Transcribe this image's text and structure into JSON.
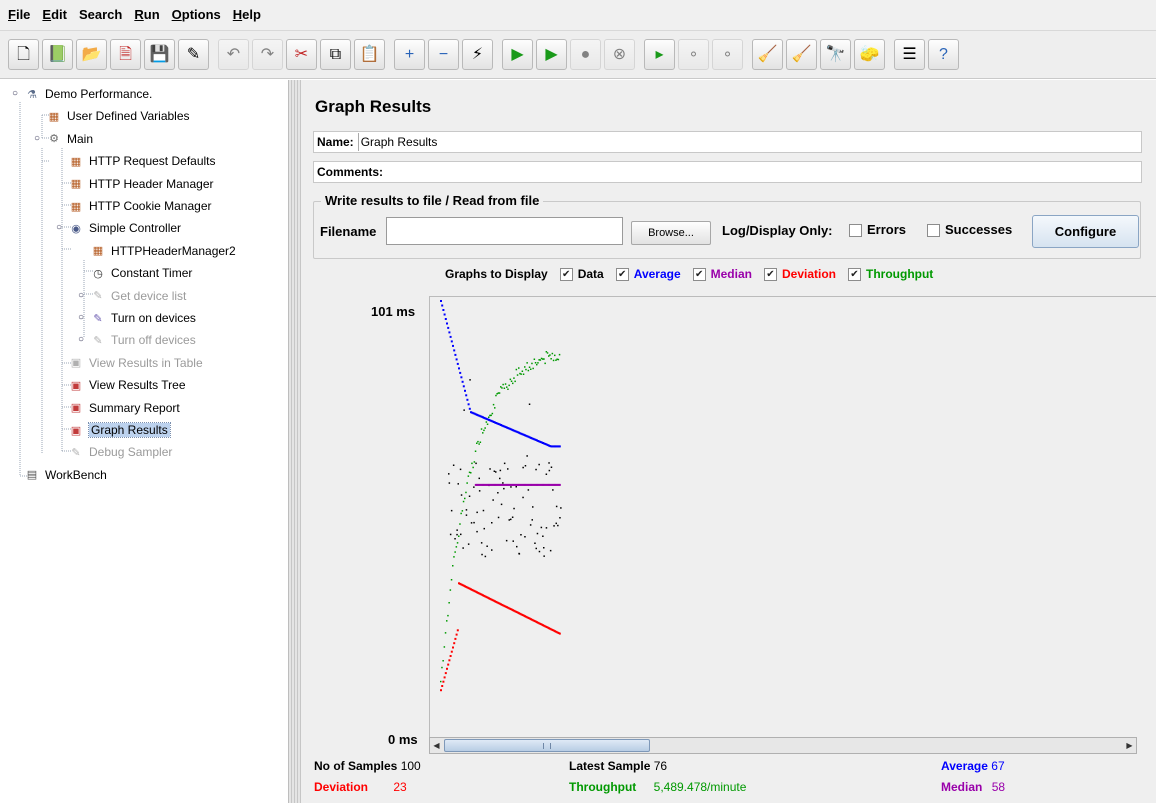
{
  "menu": [
    {
      "label": "File",
      "mnemonic_index": 0
    },
    {
      "label": "Edit",
      "mnemonic_index": 0
    },
    {
      "label": "Search",
      "mnemonic_index": -1
    },
    {
      "label": "Run",
      "mnemonic_index": 0
    },
    {
      "label": "Options",
      "mnemonic_index": 0
    },
    {
      "label": "Help",
      "mnemonic_index": 0
    }
  ],
  "toolbar": [
    {
      "name": "new-icon",
      "glyph": "🗋"
    },
    {
      "name": "templates-icon",
      "glyph": "📗"
    },
    {
      "name": "open-icon",
      "glyph": "📂"
    },
    {
      "name": "close-icon",
      "glyph": "🗎"
    },
    {
      "name": "save-icon",
      "glyph": "💾"
    },
    {
      "name": "save-as-icon",
      "glyph": "✎"
    },
    {
      "sep": true
    },
    {
      "name": "undo-icon",
      "glyph": "↶",
      "disabled": true
    },
    {
      "name": "redo-icon",
      "glyph": "↷",
      "disabled": true
    },
    {
      "name": "cut-icon",
      "glyph": "✂"
    },
    {
      "name": "copy-icon",
      "glyph": "⧉"
    },
    {
      "name": "paste-icon",
      "glyph": "📋"
    },
    {
      "sep": true
    },
    {
      "name": "expand-all-icon",
      "glyph": "+"
    },
    {
      "name": "collapse-all-icon",
      "glyph": "−"
    },
    {
      "name": "toggle-icon",
      "glyph": "⚡"
    },
    {
      "sep": true
    },
    {
      "name": "start-icon",
      "glyph": "▶"
    },
    {
      "name": "start-no-pauses-icon",
      "glyph": "▶"
    },
    {
      "name": "stop-icon",
      "glyph": "●",
      "disabled": true
    },
    {
      "name": "shutdown-icon",
      "glyph": "⊗",
      "disabled": true
    },
    {
      "sep": true
    },
    {
      "name": "remote-start-icon",
      "glyph": "▸"
    },
    {
      "name": "remote-stop-icon",
      "glyph": "∘",
      "disabled": true
    },
    {
      "name": "remote-shutdown-icon",
      "glyph": "∘",
      "disabled": true
    },
    {
      "sep": true
    },
    {
      "name": "clear-icon",
      "glyph": "🧹"
    },
    {
      "name": "clear-all-icon",
      "glyph": "🧹"
    },
    {
      "name": "search-icon",
      "glyph": "🔭"
    },
    {
      "name": "reset-search-icon",
      "glyph": "🧽"
    },
    {
      "sep": true
    },
    {
      "name": "function-helper-icon",
      "glyph": "☰"
    },
    {
      "name": "help-icon",
      "glyph": "?"
    }
  ],
  "tree": [
    {
      "label": "Demo Performance.",
      "icon": "flask-icon",
      "level": 0,
      "expanded": true
    },
    {
      "label": "User Defined Variables",
      "icon": "config-icon",
      "level": 1
    },
    {
      "label": "Main",
      "icon": "thread-group-icon",
      "level": 1,
      "expanded": true
    },
    {
      "label": "HTTP Request Defaults",
      "icon": "config-icon",
      "level": 2
    },
    {
      "label": "HTTP Header Manager",
      "icon": "config-icon",
      "level": 2
    },
    {
      "label": "HTTP Cookie Manager",
      "icon": "config-icon",
      "level": 2
    },
    {
      "label": "Simple Controller",
      "icon": "controller-icon",
      "level": 2,
      "expanded": true
    },
    {
      "label": "HTTPHeaderManager2",
      "icon": "config-icon",
      "level": 3
    },
    {
      "label": "Constant Timer",
      "icon": "timer-icon",
      "level": 3
    },
    {
      "label": "Get device list",
      "icon": "sampler-icon",
      "level": 3,
      "disabled": true,
      "collapsed": true
    },
    {
      "label": "Turn on devices",
      "icon": "sampler-icon",
      "level": 3,
      "collapsed": true
    },
    {
      "label": "Turn off devices",
      "icon": "sampler-icon",
      "level": 3,
      "disabled": true,
      "collapsed": true
    },
    {
      "label": "View Results in Table",
      "icon": "listener-icon",
      "level": 2,
      "disabled": true
    },
    {
      "label": "View Results Tree",
      "icon": "listener-icon",
      "level": 2
    },
    {
      "label": "Summary Report",
      "icon": "listener-icon",
      "level": 2
    },
    {
      "label": "Graph Results",
      "icon": "listener-icon",
      "level": 2,
      "selected": true
    },
    {
      "label": "Debug Sampler",
      "icon": "sampler-icon",
      "level": 2,
      "disabled": true
    },
    {
      "label": "WorkBench",
      "icon": "workbench-icon",
      "level": 0
    }
  ],
  "panel": {
    "title": "Graph Results",
    "name_label": "Name:",
    "name_value": "Graph Results",
    "comments_label": "Comments:",
    "comments_value": "",
    "file_section_title": "Write results to file / Read from file",
    "filename_label": "Filename",
    "filename_value": "",
    "browse_label": "Browse...",
    "log_display_label": "Log/Display Only:",
    "errors_label": "Errors",
    "errors_checked": false,
    "successes_label": "Successes",
    "successes_checked": false,
    "configure_label": "Configure"
  },
  "graphs_to_display": {
    "label": "Graphs to Display",
    "items": [
      {
        "label": "Data",
        "checked": true,
        "color": "#000000"
      },
      {
        "label": "Average",
        "checked": true,
        "color": "#0000ff"
      },
      {
        "label": "Median",
        "checked": true,
        "color": "#9900aa"
      },
      {
        "label": "Deviation",
        "checked": true,
        "color": "#ff0000"
      },
      {
        "label": "Throughput",
        "checked": true,
        "color": "#009900"
      }
    ]
  },
  "graph": {
    "y_max_label": "101  ms",
    "y_min_label": "0  ms",
    "y_max": 101,
    "y_min": 0
  },
  "stats": {
    "samples_label": "No of Samples",
    "samples_value": "100",
    "latest_label": "Latest Sample",
    "latest_value": "76",
    "average_label": "Average",
    "average_value": "67",
    "deviation_label": "Deviation",
    "deviation_value": "23",
    "throughput_label": "Throughput",
    "throughput_value": "5,489.478/minute",
    "median_label": "Median",
    "median_value": "58",
    "colors": {
      "average": "#0000ff",
      "deviation": "#ff0000",
      "throughput": "#009900",
      "median": "#9900aa"
    }
  }
}
